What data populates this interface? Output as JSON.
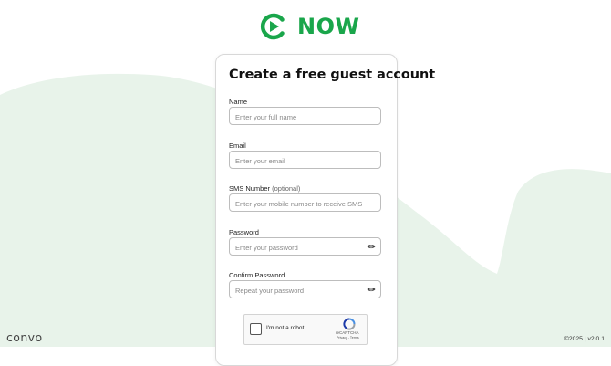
{
  "brand": {
    "name": "NOW",
    "color": "#1aa64b",
    "icon": "refresh-arrow-icon"
  },
  "background": {
    "blob_color": "#e8f3ea"
  },
  "form": {
    "title": "Create a free guest account",
    "fields": [
      {
        "label": "Name",
        "optional_note": "",
        "placeholder": "Enter your full name",
        "value": ""
      },
      {
        "label": "Email",
        "optional_note": "",
        "placeholder": "Enter your email",
        "value": ""
      },
      {
        "label": "SMS Number",
        "optional_note": "(optional)",
        "placeholder": "Enter your mobile number to receive SMS",
        "value": ""
      },
      {
        "label": "Password",
        "optional_note": "",
        "placeholder": "Enter your password",
        "value": "",
        "icon": "eye-icon"
      },
      {
        "label": "Confirm Password",
        "optional_note": "",
        "placeholder": "Repeat your password",
        "value": "",
        "icon": "eye-icon"
      }
    ]
  },
  "captcha": {
    "label": "I'm not a robot",
    "brand": "reCAPTCHA",
    "links": "Privacy - Terms",
    "icon": "recaptcha-icon"
  },
  "footer": {
    "logo": "convo",
    "version": "©2025 | v2.0.1"
  }
}
